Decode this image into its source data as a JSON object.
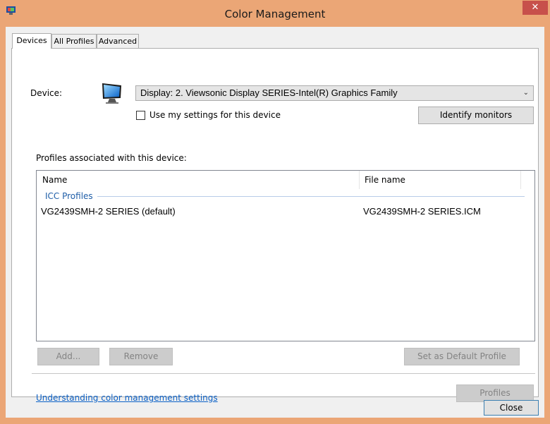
{
  "window": {
    "title": "Color Management",
    "close_glyph": "✕"
  },
  "tabs": [
    {
      "label": "Devices",
      "active": true
    },
    {
      "label": "All Profiles",
      "active": false
    },
    {
      "label": "Advanced",
      "active": false
    }
  ],
  "device": {
    "label": "Device:",
    "selected": "Display: 2. Viewsonic Display SERIES-Intel(R) Graphics Family",
    "use_settings_label": "Use my settings for this device",
    "use_settings_checked": false,
    "identify_button": "Identify monitors"
  },
  "profiles": {
    "section_label": "Profiles associated with this device:",
    "columns": [
      "Name",
      "File name"
    ],
    "group": "ICC Profiles",
    "rows": [
      {
        "name": "VG2439SMH-2 SERIES (default)",
        "file": "VG2439SMH-2 SERIES.ICM"
      }
    ]
  },
  "buttons": {
    "add": "Add...",
    "remove": "Remove",
    "set_default": "Set as Default Profile",
    "profiles": "Profiles",
    "close": "Close"
  },
  "link": "Understanding color management settings",
  "icons": {
    "app": "color-management-icon",
    "device": "monitor-icon",
    "dropdown": "chevron-down-icon"
  },
  "colors": {
    "frame": "#eba676",
    "close_button": "#c7504b",
    "link": "#0b61c7",
    "group_header": "#1f5ea8"
  }
}
